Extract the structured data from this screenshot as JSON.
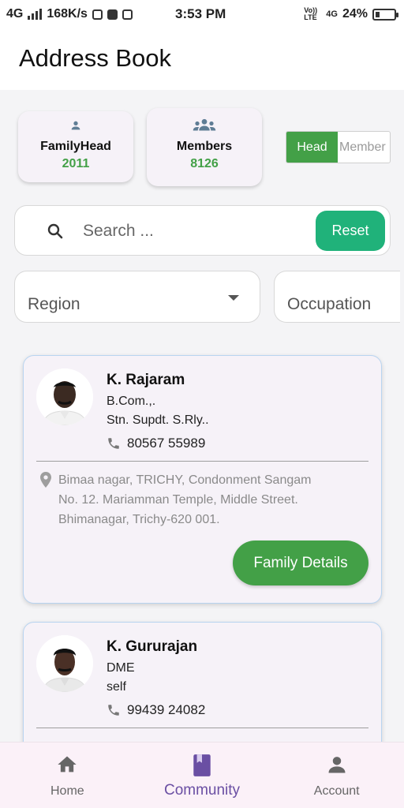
{
  "status_bar": {
    "network": "4G",
    "speed": "168K/s",
    "time": "3:53 PM",
    "volte": "Vo)) LTE",
    "network2": "4G",
    "battery": "24%",
    "battery_level": 0.24
  },
  "app": {
    "title": "Address Book"
  },
  "stats": {
    "family_head": {
      "label": "FamilyHead",
      "count": "2011",
      "icon": "person-icon"
    },
    "members": {
      "label": "Members",
      "count": "8126",
      "icon": "group-icon"
    }
  },
  "toggle": {
    "selected": "Head",
    "other": "Member"
  },
  "search": {
    "placeholder": "Search ...",
    "value": "",
    "reset_label": "Reset"
  },
  "filters": {
    "region": "Region",
    "occupation": "Occupation"
  },
  "contacts": [
    {
      "name": "K. Rajaram",
      "qualification": "B.Com.,.",
      "designation": "Stn. Supdt. S.Rly..",
      "phone": "80567 55989",
      "address_line1": "Bimaa nagar, TRICHY, Condonment Sangam",
      "address_line2": "No. 12. Mariamman Temple, Middle Street.",
      "address_line3": "Bhimanagar, Trichy-620 001.",
      "button": "Family Details"
    },
    {
      "name": "K. Gururajan",
      "qualification": "DME",
      "designation": "self",
      "phone": "99439 24082"
    }
  ],
  "bottom_nav": [
    {
      "label": "Home",
      "icon": "home-icon"
    },
    {
      "label": "Community",
      "icon": "book-icon",
      "active": true
    },
    {
      "label": "Account",
      "icon": "account-icon"
    }
  ],
  "colors": {
    "accent_green": "#43a047",
    "reset_green": "#20b27a",
    "nav_active": "#6a4fa3"
  }
}
